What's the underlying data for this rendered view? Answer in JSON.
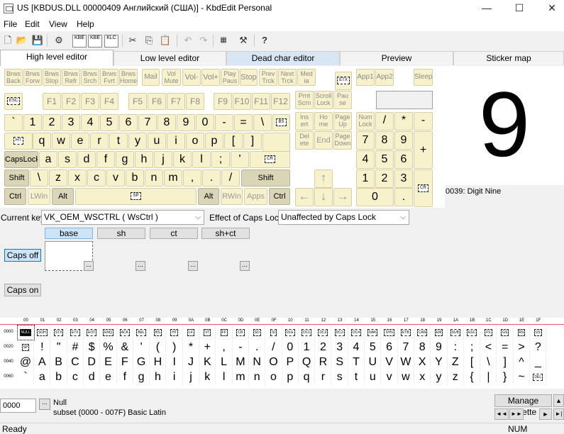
{
  "window": {
    "title": "US [KBDUS.DLL 00000409 Английский (США)] - KbdEdit Personal",
    "minimize": "—",
    "maximize": "☐",
    "close": "✕"
  },
  "menu": [
    "File",
    "Edit",
    "View",
    "Help"
  ],
  "toolbar": {
    "kbe1": "KBE",
    "kbe2": "KBE",
    "klc": "KLC",
    "icons": [
      "new-file-icon",
      "open-folder-icon",
      "save-icon",
      "gear-icon",
      "import-kbe-icon",
      "export-kbe-icon",
      "klc-icon",
      "cut-icon",
      "copy-icon",
      "paste-icon",
      "undo-icon",
      "redo-icon",
      "compile-icon",
      "tools-icon",
      "help-icon"
    ]
  },
  "tabs": [
    "High level editor",
    "Low level editor",
    "Dead char editor",
    "Preview",
    "Sticker map"
  ],
  "keyboard": {
    "media": [
      [
        "Brws\nBack",
        "Brws\nForw",
        "Brws\nStop",
        "Brws\nRefr",
        "Brws\nSrch",
        "Brws\nFvrt",
        "Brws\nHome",
        "Mail",
        "Vol\nMute",
        "Vol-",
        "Vol+",
        "Play\nPaus",
        "Stop",
        "Prev\nTrck",
        "Next\nTrck",
        "Med\nia"
      ],
      [
        "App1",
        "App2",
        "Sleep"
      ]
    ],
    "etx": "ETX",
    "esc": "ESC",
    "fkeys": [
      "F1",
      "F2",
      "F3",
      "F4",
      "F5",
      "F6",
      "F7",
      "F8",
      "F9",
      "F10",
      "F11",
      "F12"
    ],
    "prt": [
      "Prnt\nScrn",
      "Scroll\nLock",
      "Pau\nse"
    ],
    "row1": [
      "`",
      "1",
      "2",
      "3",
      "4",
      "5",
      "6",
      "7",
      "8",
      "9",
      "0",
      "-",
      "="
    ],
    "backslash_top": "\\",
    "bs": "BS",
    "ins": [
      "Ins\nert",
      "Ho\nme",
      "Page\nUp"
    ],
    "numrow1": [
      "Num\nLock",
      "/",
      "*",
      "-"
    ],
    "ht": "HT",
    "row2": [
      "q",
      "w",
      "e",
      "r",
      "t",
      "y",
      "u",
      "i",
      "o",
      "p",
      "[",
      "]"
    ],
    "del": [
      "Del\nete",
      "End",
      "Page\nDown"
    ],
    "numrow2": [
      "7",
      "8",
      "9"
    ],
    "plus": "+",
    "capslock": "CapsLock",
    "row3": [
      "a",
      "s",
      "d",
      "f",
      "g",
      "h",
      "j",
      "k",
      "l",
      ";",
      "'"
    ],
    "cr": "CR",
    "numrow3": [
      "4",
      "5",
      "6"
    ],
    "shift_l": "Shift",
    "row4": [
      "\\",
      "z",
      "x",
      "c",
      "v",
      "b",
      "n",
      "m",
      ",",
      ".",
      "/"
    ],
    "shift_r": "Shift",
    "up": "↑",
    "numrow4": [
      "1",
      "2",
      "3"
    ],
    "bottom": {
      "ctrl_l": "Ctrl",
      "lwin": "LWin",
      "alt_l": "Alt",
      "sp": "SP",
      "alt_r": "Alt",
      "rwin": "RWin",
      "apps": "Apps",
      "ctrl_r": "Ctrl"
    },
    "arrows": [
      "←",
      "↓",
      "→"
    ],
    "num0": "0",
    "numdot": "."
  },
  "char_panel": {
    "glyph": "9",
    "name": "0039: Digit Nine"
  },
  "current_key": {
    "label": "Current key",
    "value": "VK_OEM_WSCTRL ( WsCtrl )"
  },
  "caps_effect": {
    "label": "Effect of Caps Lock",
    "value": "Unaffected by Caps Lock"
  },
  "shift_states": [
    "base",
    "sh",
    "ct",
    "sh+ct"
  ],
  "caps_off": "Caps off",
  "caps_on": "Caps on",
  "dots": "...",
  "grid": {
    "cols": [
      "00",
      "01",
      "02",
      "03",
      "04",
      "05",
      "06",
      "07",
      "08",
      "09",
      "0A",
      "0B",
      "0C",
      "0D",
      "0E",
      "0F",
      "10",
      "11",
      "12",
      "13",
      "14",
      "15",
      "16",
      "17",
      "18",
      "19",
      "1A",
      "1B",
      "1C",
      "1D",
      "1E",
      "1F"
    ],
    "rows": [
      "0000",
      "0020",
      "0040",
      "0060"
    ],
    "row0": [
      "NULL",
      "SOH",
      "STX",
      "ETX",
      "EOT",
      "ENQ",
      "ACK",
      "BEL",
      "BS",
      "HT",
      "LF",
      "VT",
      "FF",
      "CR",
      "SO",
      "SI",
      "DLE",
      "DC1",
      "DC2",
      "DC3",
      "DC4",
      "NAK",
      "SYN",
      "ETB",
      "CAN",
      "EM",
      "SUB",
      "ESC",
      "FS",
      "GS",
      "RS",
      "US"
    ],
    "row1": [
      "SP",
      "!",
      "\"",
      "#",
      "$",
      "%",
      "&",
      "'",
      "(",
      ")",
      "*",
      "+",
      ",",
      "-",
      ".",
      "/",
      "0",
      "1",
      "2",
      "3",
      "4",
      "5",
      "6",
      "7",
      "8",
      "9",
      ":",
      ";",
      "<",
      "=",
      ">",
      "?"
    ],
    "row2": [
      "@",
      "A",
      "B",
      "C",
      "D",
      "E",
      "F",
      "G",
      "H",
      "I",
      "J",
      "K",
      "L",
      "M",
      "N",
      "O",
      "P",
      "Q",
      "R",
      "S",
      "T",
      "U",
      "V",
      "W",
      "X",
      "Y",
      "Z",
      "[",
      "\\",
      "]",
      "^",
      "_"
    ],
    "row3": [
      "`",
      "a",
      "b",
      "c",
      "d",
      "e",
      "f",
      "g",
      "h",
      "i",
      "j",
      "k",
      "l",
      "m",
      "n",
      "o",
      "p",
      "q",
      "r",
      "s",
      "t",
      "u",
      "v",
      "w",
      "x",
      "y",
      "z",
      "{",
      "|",
      "}",
      "~",
      "DEL"
    ]
  },
  "code_input": "0000",
  "code_name": "Null",
  "subset": "subset (0000 - 007F) Basic Latin",
  "manage_palette": "Manage Palette",
  "nav": [
    "◄◄",
    "►►",
    "►",
    "►|"
  ],
  "status": {
    "left": "Ready",
    "num": "NUM"
  }
}
